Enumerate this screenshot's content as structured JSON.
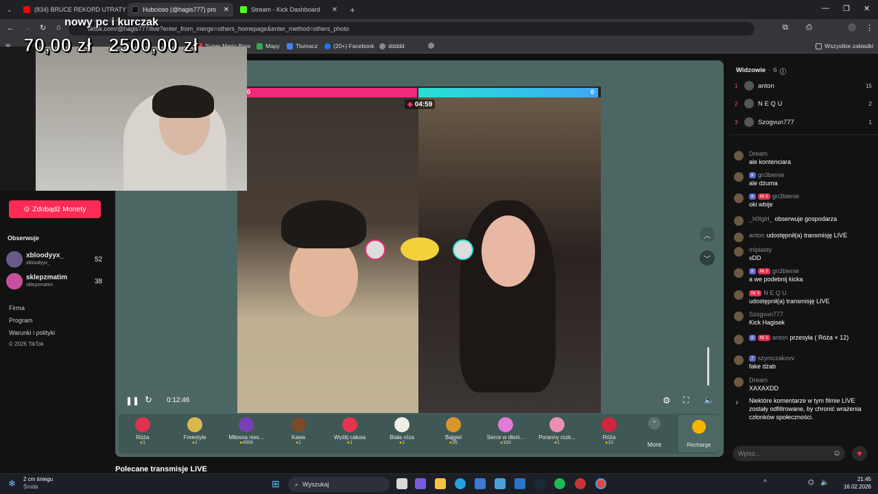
{
  "tabs": [
    {
      "label": "(834) BRUCE REKORD UTRATY",
      "color": "#ff0000"
    },
    {
      "label": "Hubcioso (@hagis777) pro",
      "color": "#111111"
    },
    {
      "label": "Stream - Kick Dashboard",
      "color": "#53fc18"
    }
  ],
  "new_tab": "+",
  "url": "tiktok.com/@hagis777/live?enter_from_merge=others_homepage&enter_method=others_photo",
  "bookmarks": [
    "Super Mario Bros",
    "Mapy",
    "Tłumacz",
    "(20+) Facebook",
    "ddddd"
  ],
  "all_bookmarks": "Wszystkie zakładki",
  "overlay": {
    "title": "nowy pc i kurczak",
    "amount1": "70,00 zł",
    "amount2": "2500,00 zł"
  },
  "left": {
    "coins_button": "Zdobądź Monety",
    "following_header": "Obserwuje",
    "following": [
      {
        "name": "xbloodyyx_",
        "handle": "xbloodyyx_",
        "count": "52"
      },
      {
        "name": "sklepzmatim",
        "handle": "sklepzmatim",
        "count": "38"
      }
    ],
    "links": [
      "Firma",
      "Program",
      "Warunki i polityki"
    ],
    "copyright": "© 2026 TikTok",
    "recommended": "Polecane transmisje LIVE"
  },
  "battle": {
    "left_score": "0",
    "right_score": "0",
    "timer": "04:59"
  },
  "controls": {
    "elapsed": "0:12:46"
  },
  "gifts": [
    {
      "name": "Róża",
      "price": "1",
      "color": "#e0314f"
    },
    {
      "name": "Freestyle",
      "price": "1",
      "color": "#d9b84a"
    },
    {
      "name": "Miłosna nies...",
      "price": "4999",
      "color": "#7a3fb8"
    },
    {
      "name": "Kawa",
      "price": "1",
      "color": "#7a4a2a"
    },
    {
      "name": "Wyślij całusa",
      "price": "1",
      "color": "#e83350"
    },
    {
      "name": "Biała róża",
      "price": "1",
      "color": "#f0efe6"
    },
    {
      "name": "Bajgiel",
      "price": "35",
      "color": "#d9942a"
    },
    {
      "name": "Serce w dłoni...",
      "price": "100",
      "color": "#e27ad8"
    },
    {
      "name": "Poranny rozk...",
      "price": "1",
      "color": "#e98fb0"
    },
    {
      "name": "Róża",
      "price": "10",
      "color": "#d0243f"
    }
  ],
  "more_label": "More",
  "recharge_label": "Recharge",
  "viewers": {
    "title": "Widzowie",
    "count": "6",
    "list": [
      {
        "rank": "1",
        "name": "anton",
        "count": "15"
      },
      {
        "rank": "2",
        "name": "N E Q U",
        "count": "2"
      },
      {
        "rank": "3",
        "name": "Szogvun777",
        "count": "1"
      }
    ]
  },
  "chat": [
    {
      "user": "Dream",
      "text": "ale kontenciara"
    },
    {
      "user": "gn3bienie",
      "badges": [
        "8"
      ],
      "text": "ale dżuma"
    },
    {
      "user": "gn3bienie",
      "badges": [
        "8",
        "Nr 2"
      ],
      "text": "oki wbije"
    },
    {
      "user": "_h0tgirl_",
      "text": "obserwuje gospodarza",
      "inline": true
    },
    {
      "user": "anton",
      "text": "udostępnił(a) transmisję LIVE",
      "inline": true
    },
    {
      "user": "mipiasty",
      "text": "xDD"
    },
    {
      "user": "gn3bienie",
      "badges": [
        "8",
        "Nr 2"
      ],
      "text": "a we podebnij kicka"
    },
    {
      "user": "N E Q U",
      "badges": [
        "Nr 3"
      ],
      "text": "udostępnił(a) transmisję LIVE"
    },
    {
      "user": "Szogvun777",
      "text": "Kick Hagisek"
    },
    {
      "user": "anton",
      "badges": [
        "8",
        "Nr 1"
      ],
      "text": "przesyła ( Róża × 12)",
      "inline": true
    },
    {
      "user": "szymczakovv",
      "badges": [
        "7"
      ],
      "text": "fake dżab"
    },
    {
      "user": "Dream",
      "text": "XAXAXDD"
    }
  ],
  "filter_notice": "Niektóre komentarze w tym filmie LIVE zostały odfiltrowane, by chronić wrażenia członków społeczności.",
  "chat_placeholder": "Wpisz...",
  "taskbar": {
    "weather": "2 cm śniegu",
    "weather_sub": "Środa",
    "search": "Wyszukaj",
    "time": "21:45",
    "date": "16.02.2026"
  }
}
